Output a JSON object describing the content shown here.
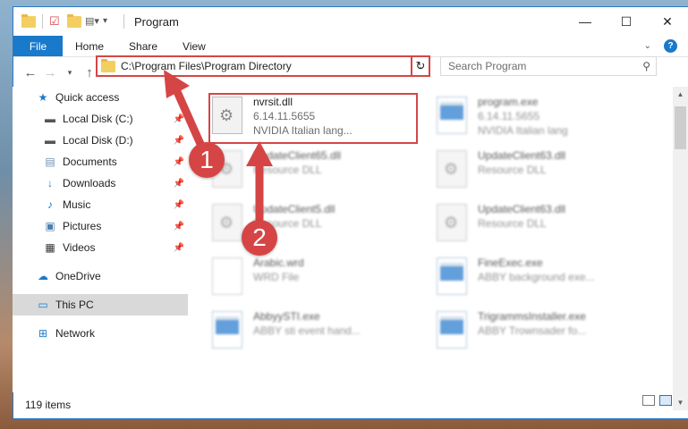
{
  "window": {
    "title": "Program"
  },
  "ribbon": {
    "file": "File",
    "home": "Home",
    "share": "Share",
    "view": "View",
    "help": "?"
  },
  "address": {
    "path": "C:\\Program Files\\Program Directory"
  },
  "search": {
    "placeholder": "Search Program"
  },
  "nav": {
    "items": [
      {
        "label": "Quick access",
        "icon": "star-icon",
        "pinned": false
      },
      {
        "label": "Local Disk (C:)",
        "icon": "drive-icon",
        "pinned": true
      },
      {
        "label": "Local Disk (D:)",
        "icon": "drive-icon",
        "pinned": true
      },
      {
        "label": "Documents",
        "icon": "documents-icon",
        "pinned": true
      },
      {
        "label": "Downloads",
        "icon": "downloads-icon",
        "pinned": true
      },
      {
        "label": "Music",
        "icon": "music-icon",
        "pinned": true
      },
      {
        "label": "Pictures",
        "icon": "pictures-icon",
        "pinned": true
      },
      {
        "label": "Videos",
        "icon": "videos-icon",
        "pinned": true
      }
    ],
    "onedrive": "OneDrive",
    "thispc": "This PC",
    "network": "Network"
  },
  "files": [
    {
      "name": "nvrsit.dll",
      "line2": "6.14.11.5655",
      "line3": "NVIDIA Italian lang...",
      "icon": "dll"
    },
    {
      "name": "program.exe",
      "line2": "6.14.11.5655",
      "line3": "NVIDIA Italian lang",
      "icon": "exe"
    },
    {
      "name": "UpdateClient65.dll",
      "line2": "Resource DLL",
      "line3": "",
      "icon": "dll"
    },
    {
      "name": "UpdateClient63.dll",
      "line2": "Resource DLL",
      "line3": "",
      "icon": "dll"
    },
    {
      "name": "UpdateClient5.dll",
      "line2": "Resource DLL",
      "line3": "",
      "icon": "dll"
    },
    {
      "name": "UpdateClient63.dll",
      "line2": "Resource DLL",
      "line3": "",
      "icon": "dll"
    },
    {
      "name": "Arabic.wrd",
      "line2": "WRD File",
      "line3": "",
      "icon": "txt"
    },
    {
      "name": "FineExec.exe",
      "line2": "ABBY background exe...",
      "line3": "",
      "icon": "exe"
    },
    {
      "name": "AbbyySTI.exe",
      "line2": "ABBY sti event hand...",
      "line3": "",
      "icon": "exe"
    },
    {
      "name": "TrigrammsInstaller.exe",
      "line2": "ABBY Trownsader fo...",
      "line3": "",
      "icon": "exe"
    }
  ],
  "status": {
    "count": "119 items"
  },
  "callouts": [
    "1",
    "2"
  ],
  "colors": {
    "accent": "#1979ca",
    "highlight": "#d64545"
  }
}
